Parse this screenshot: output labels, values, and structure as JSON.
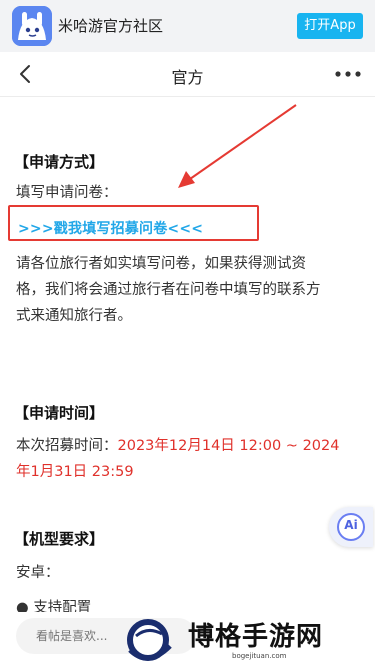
{
  "app_banner": {
    "app_name": "米哈游官方社区",
    "open_app_label": "打开App"
  },
  "navbar": {
    "title": "官方"
  },
  "post": {
    "apply_method_title": "【申请方式】",
    "fill_survey_label": "填写申请问卷：",
    "survey_link_text": ">>>戳我填写招募问卷<<<",
    "instruction_line1": "请各位旅行者如实填写问卷，如果获得测试资",
    "instruction_line2": "格，我们将会通过旅行者在问卷中填写的联系方",
    "instruction_line3": "式来通知旅行者。",
    "apply_time_title": "【申请时间】",
    "recruit_time_label": "本次招募时间：",
    "recruit_time_line1": "2023年12月14日 12:00 ~ 2024",
    "recruit_time_line2": "年1月31日 23:59",
    "device_title": "【机型要求】",
    "android_label": "安卓：",
    "support_config_label": "● 支持配置"
  },
  "bottom_bar": {
    "comment_placeholder": "看帖是喜欢..."
  },
  "watermark": {
    "brand": "博格手游网",
    "url": "bogejituan.com"
  },
  "ai_button": {
    "label": "Ai"
  },
  "colors": {
    "accent": "#18b4f0",
    "link": "#22a7e8",
    "highlight_red": "#e0312b"
  }
}
